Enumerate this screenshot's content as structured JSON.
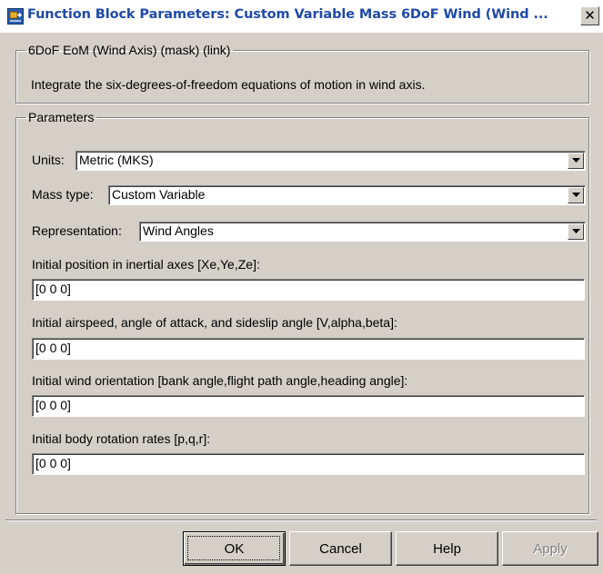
{
  "window": {
    "title": "Function Block Parameters: Custom Variable Mass 6DoF Wind (Wind ...",
    "icon": "simulink-block-icon",
    "close_glyph": "✕"
  },
  "description_group": {
    "legend": "6DoF EoM (Wind Axis) (mask) (link)",
    "text": "Integrate the six-degrees-of-freedom equations of motion in wind axis."
  },
  "parameters": {
    "legend": "Parameters",
    "units": {
      "label": "Units:",
      "value": "Metric (MKS)"
    },
    "mass_type": {
      "label": "Mass type:",
      "value": "Custom Variable"
    },
    "representation": {
      "label": "Representation:",
      "value": "Wind Angles"
    },
    "initial_position": {
      "label": "Initial position in inertial axes [Xe,Ye,Ze]:",
      "value": "[0 0 0]"
    },
    "initial_airspeed": {
      "label": "Initial airspeed, angle of attack, and sideslip angle [V,alpha,beta]:",
      "value": "[0 0 0]"
    },
    "initial_orientation": {
      "label": "Initial wind orientation [bank angle,flight path angle,heading angle]:",
      "value": "[0 0 0]"
    },
    "initial_rates": {
      "label": "Initial body rotation rates [p,q,r]:",
      "value": "[0 0 0]"
    }
  },
  "buttons": {
    "ok": "OK",
    "cancel": "Cancel",
    "help": "Help",
    "apply": "Apply"
  },
  "colors": {
    "dialog_face": "#d4d0c8",
    "title_text": "#1f4aa8",
    "disabled_text": "#808080"
  }
}
